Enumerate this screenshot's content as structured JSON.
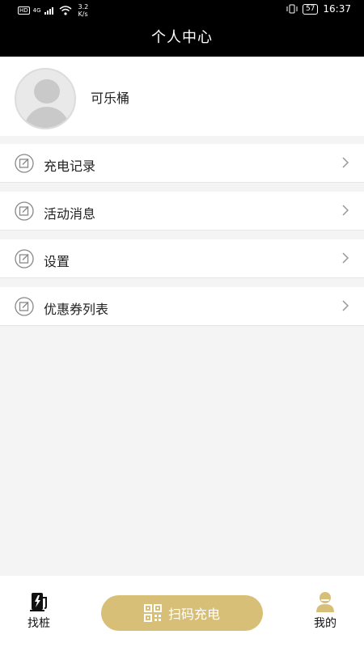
{
  "status_bar": {
    "hd": "HD",
    "network": "4G",
    "speed_value": "3.2",
    "speed_unit": "K/s",
    "battery": "57",
    "time": "16:37"
  },
  "header": {
    "title": "个人中心"
  },
  "profile": {
    "username": "可乐桶"
  },
  "menu": {
    "items": [
      {
        "label": "充电记录"
      },
      {
        "label": "活动消息"
      },
      {
        "label": "设置"
      },
      {
        "label": "优惠券列表"
      }
    ]
  },
  "tabbar": {
    "find_label": "找桩",
    "scan_label": "扫码充电",
    "mine_label": "我的"
  },
  "colors": {
    "accent": "#d8bf77",
    "header_bg": "#000000"
  }
}
